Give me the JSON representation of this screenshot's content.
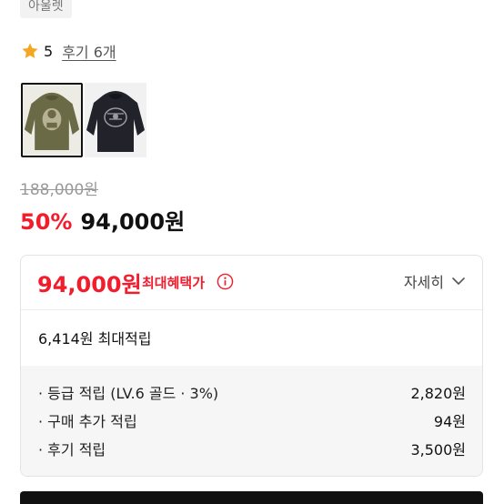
{
  "brand_tag": "아울렛",
  "rating": {
    "score": "5",
    "review_link": "후기 6개",
    "star_color": "#f5a623"
  },
  "thumbnails": [
    {
      "name": "olive hoodie",
      "color": "#6b6a46",
      "selected": true
    },
    {
      "name": "black hoodie",
      "color": "#22232a",
      "selected": false
    }
  ],
  "price": {
    "original": "188,000원",
    "discount": "50%",
    "sale": "94,000원"
  },
  "benefit": {
    "price": "94,000원",
    "label": "최대혜택가",
    "detail_label": "자세히",
    "max_points": "6,414원 최대적립",
    "rows": [
      {
        "label": "· 등급 적립 (LV.6 골드 · 3%)",
        "value": "2,820원"
      },
      {
        "label": "· 구매 추가 적립",
        "value": "94원"
      },
      {
        "label": "· 후기 적립",
        "value": "3,500원"
      }
    ]
  },
  "colors": {
    "accent_red": "#f31c2c",
    "star": "#f5a623",
    "panel_bg": "#f6f6f6"
  }
}
